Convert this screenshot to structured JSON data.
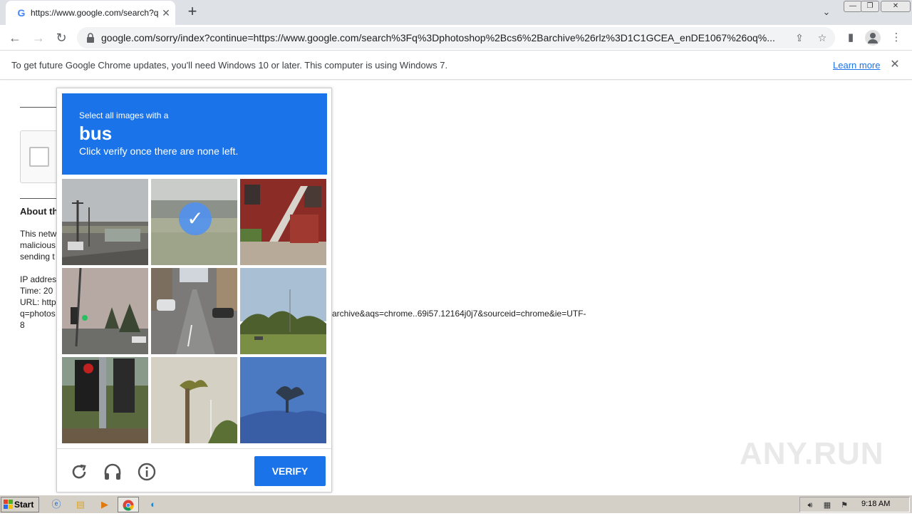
{
  "browser": {
    "tab_title": "https://www.google.com/search?q=",
    "tab_favicon": "G",
    "new_tab_label": "+",
    "url": "google.com/sorry/index?continue=https://www.google.com/search%3Fq%3Dphotoshop%2Bcs6%2Barchive%26rlz%3D1C1GCEA_enDE1067%26oq%..."
  },
  "infobar": {
    "message": "To get future Google Chrome updates, you'll need Windows 10 or later. This computer is using Windows 7.",
    "link": "Learn more"
  },
  "page": {
    "about_title": "About th",
    "lines": [
      "This netw",
      "malicious",
      "sending t"
    ],
    "ip_line": "IP addres",
    "time_line": "Time: 20",
    "url_line": "URL: http",
    "q_line": "q=photos",
    "eight_line": "8",
    "url_rest": "archive&aqs=chrome..69i57.12164j0j7&sourceid=chrome&ie=UTF-"
  },
  "captcha": {
    "instruction_small": "Select all images with a",
    "target": "bus",
    "instruction_sub": "Click verify once there are none left.",
    "verify_label": "VERIFY",
    "tiles": [
      {
        "scene": "street-poles",
        "selected": false
      },
      {
        "scene": "field-trees",
        "selected": true
      },
      {
        "scene": "red-building-stairs",
        "selected": false
      },
      {
        "scene": "traffic-light-overcast",
        "selected": false
      },
      {
        "scene": "city-street-cars",
        "selected": false
      },
      {
        "scene": "roadside-trees",
        "selected": false
      },
      {
        "scene": "traffic-lights-closeup",
        "selected": false
      },
      {
        "scene": "palm-tree",
        "selected": false
      },
      {
        "scene": "blue-palm-silhouette",
        "selected": false
      }
    ],
    "accent": "#1a73e8"
  },
  "watermark": "ANY.RUN",
  "taskbar": {
    "start_label": "Start",
    "clock": "9:18 AM"
  }
}
